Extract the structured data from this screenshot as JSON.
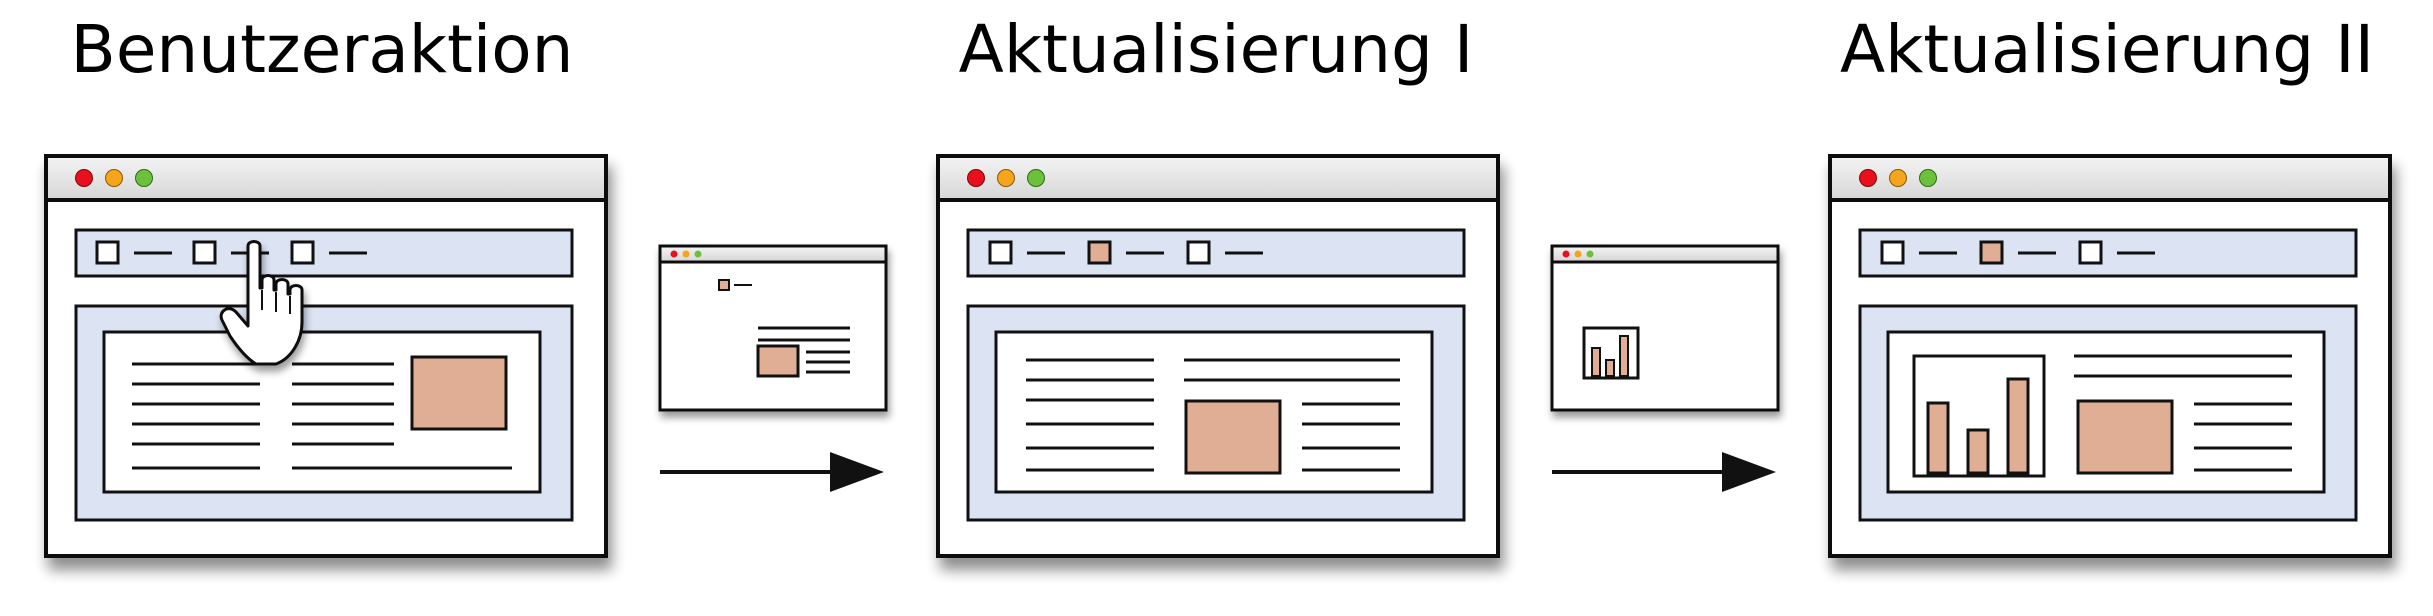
{
  "stages": [
    {
      "title": "Benutzeraktion"
    },
    {
      "title": "Aktualisierung I"
    },
    {
      "title": "Aktualisierung II"
    }
  ],
  "colors": {
    "window_border": "#111111",
    "titlebar": "#e6e6e6",
    "panel_fill": "#dce3f3",
    "placeholder_box": "#dfae94",
    "traffic_red": "#e8101c",
    "traffic_yellow": "#f4a51c",
    "traffic_green": "#6cc13c"
  },
  "icons": [
    "hand-pointer-cursor-icon",
    "arrow-right-icon",
    "traffic-light-icon"
  ]
}
